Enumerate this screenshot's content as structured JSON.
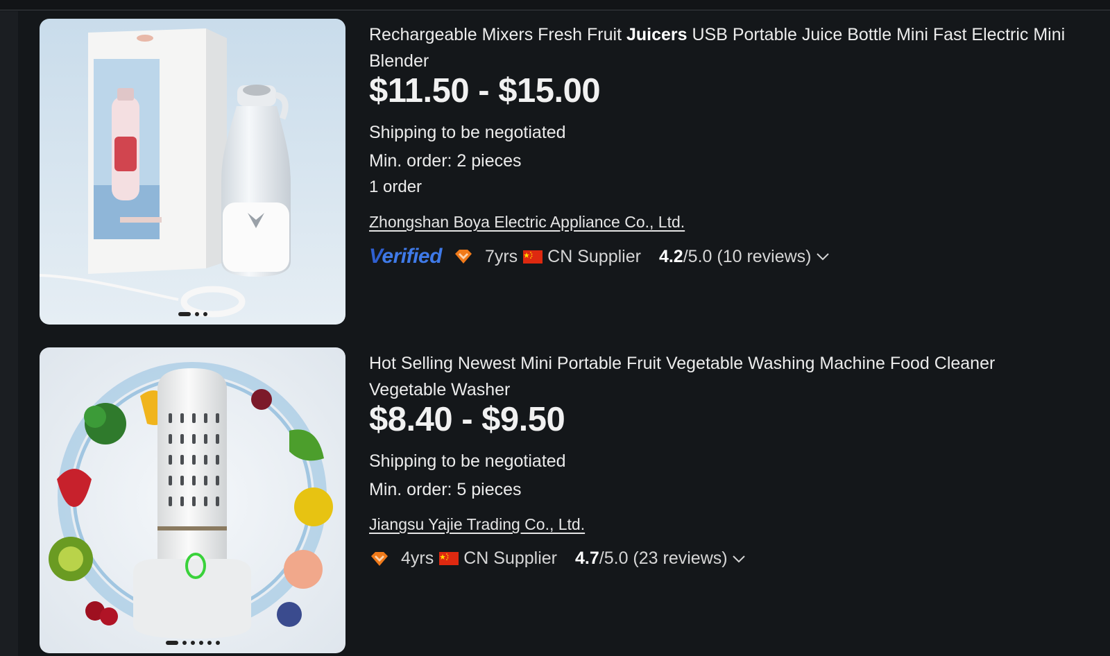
{
  "products": [
    {
      "title_before": "Rechargeable Mixers Fresh Fruit ",
      "title_bold": "Juicers",
      "title_after": " USB Portable Juice Bottle Mini Fast Electric Mini Blender",
      "price": "$11.50 - $15.00",
      "shipping": "Shipping to be negotiated",
      "min_order": "Min. order: 2 pieces",
      "orders": "1 order",
      "supplier": "Zhongshan Boya Electric Appliance Co., Ltd.",
      "verified_v": "V",
      "verified_rest": "erified",
      "years": "7yrs",
      "country_label": "CN Supplier",
      "rating": "4.2",
      "rating_rest": "/5.0 (10 reviews)",
      "image_icon": "portable-blender-image",
      "carousel_count": 3
    },
    {
      "title_before": "Hot Selling Newest Mini Portable Fruit Vegetable Washing Machine Food Cleaner Vegetable Washer",
      "title_bold": "",
      "title_after": "",
      "price": "$8.40 - $9.50",
      "shipping": "Shipping to be negotiated",
      "min_order": "Min. order: 5 pieces",
      "supplier": "Jiangsu Yajie Trading Co., Ltd.",
      "years": "4yrs",
      "country_label": "CN Supplier",
      "rating": "4.7",
      "rating_rest": "/5.0 (23 reviews)",
      "image_icon": "vegetable-washer-image",
      "carousel_count": 6
    }
  ],
  "colors": {
    "background": "#14171a",
    "verified_blue": "#3f7ae8",
    "gem_orange": "#f07a1a",
    "flag_red": "#de2910",
    "flag_yellow": "#ffde00"
  }
}
